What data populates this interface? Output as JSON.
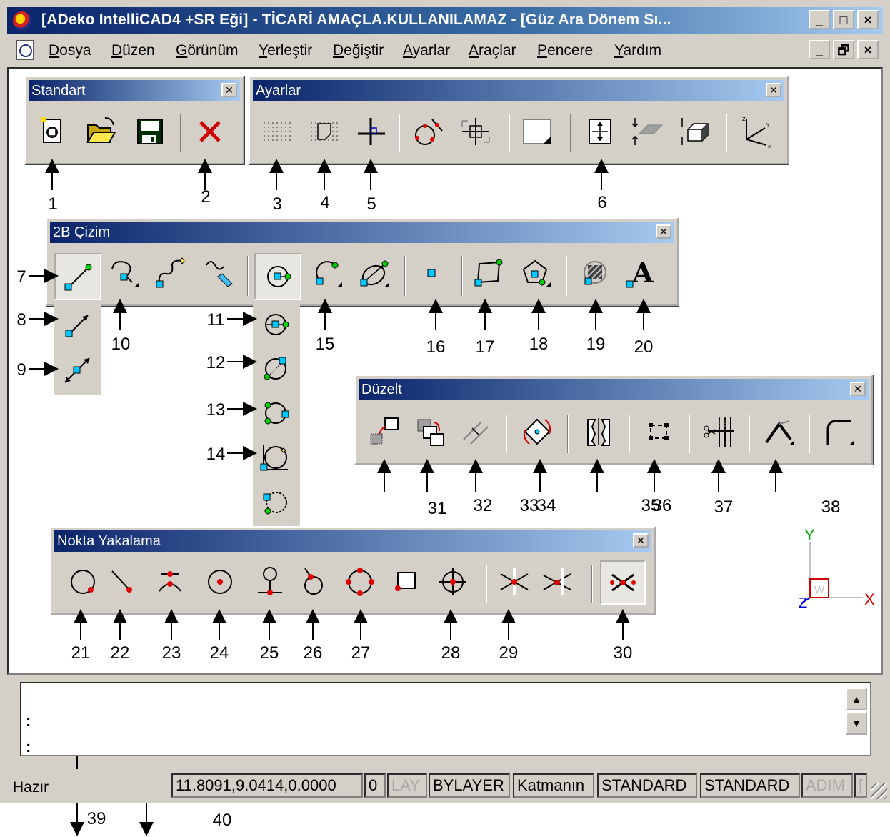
{
  "window": {
    "title": "[ADeko IntelliCAD4 +SR Eği] -  TİCARİ AMAÇLA.KULLANILAMAZ  - [Güz Ara Dönem Sı...",
    "title_controls": [
      "_",
      "□",
      "×"
    ],
    "doc_controls": [
      "_",
      "🗗",
      "×"
    ]
  },
  "menu": {
    "items": [
      "Dosya",
      "Düzen",
      "Görünüm",
      "Yerleştir",
      "Değiştir",
      "Ayarlar",
      "Araçlar",
      "Pencere",
      "Yardım"
    ]
  },
  "toolbars": {
    "standart": {
      "title": "Standart",
      "icons": [
        "new-file-icon",
        "open-folder-icon",
        "save-disk-icon",
        "close-x-icon"
      ]
    },
    "ayarlar": {
      "title": "Ayarlar",
      "icons": [
        "grid-icon",
        "snap-grid-icon",
        "ortho-icon",
        "osnap-icon",
        "cursor-crosshair-icon",
        "layer-color-icon",
        "view-zoom-icon",
        "elevation-icon",
        "thickness-icon",
        "ucs-axis-icon"
      ]
    },
    "cizim2b": {
      "title": "2B Çizim",
      "icons": [
        "line-icon",
        "polyline-icon",
        "spline-icon",
        "sketch-icon",
        "circle-icon",
        "arc-icon",
        "ellipse-icon",
        "point-icon",
        "rectangle-icon",
        "polygon-icon",
        "hatch-icon",
        "text-icon"
      ],
      "text_icon_glyph": "A"
    },
    "duzelt": {
      "title": "Düzelt",
      "icons": [
        "move-icon",
        "copy-icon",
        "offset-icon",
        "rotate-icon",
        "mirror-icon",
        "stretch-icon",
        "trim-icon",
        "chamfer-icon",
        "fillet-icon"
      ]
    },
    "nokta": {
      "title": "Nokta Yakalama",
      "icons": [
        "nearest-icon",
        "endpoint-icon",
        "intersection-icon",
        "center-icon",
        "perpendicular-icon",
        "tangent-icon",
        "quadrant-icon",
        "node-icon",
        "insertion-icon",
        "apparent-intersection-icon",
        "clear-snaps-icon"
      ]
    }
  },
  "callouts": [
    "1",
    "2",
    "3",
    "4",
    "5",
    "6",
    "7",
    "8",
    "9",
    "10",
    "11",
    "12",
    "13",
    "14",
    "15",
    "16",
    "17",
    "18",
    "19",
    "20",
    "21",
    "22",
    "23",
    "24",
    "25",
    "26",
    "27",
    "28",
    "29",
    "30",
    "31",
    "32",
    "33",
    "34",
    "35",
    "36",
    "37",
    "38",
    "39",
    "40"
  ],
  "ucs": {
    "y": "Y",
    "z": "Z",
    "x": "X",
    "w": "W"
  },
  "command_line": {
    "prompt1": ":",
    "prompt2": ":"
  },
  "status": {
    "ready": "Hazır",
    "coords": "11.8091,9.0414,0.0000",
    "layer": "0",
    "lay": "LAY",
    "color": "BYLAYER",
    "linetype": "Katmanın",
    "style1": "STANDARD",
    "style2": "STANDARD",
    "adim": "ADIM",
    "bracket": "["
  }
}
